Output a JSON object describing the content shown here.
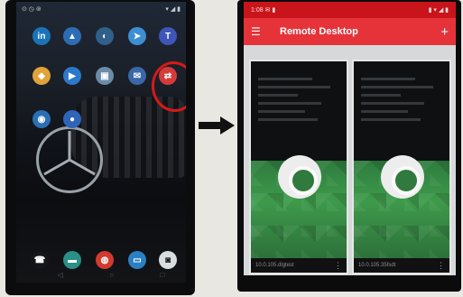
{
  "left_phone": {
    "status": {
      "left": "⊙ ◷ ⊚",
      "right": "▾ ◢ ▮"
    },
    "apps_row1": [
      {
        "icon": "linkedin-icon",
        "glyph": "in",
        "color": "#1a73b8"
      },
      {
        "icon": "drive-icon",
        "glyph": "▲",
        "color": "#2d6db3"
      },
      {
        "icon": "app-icon",
        "glyph": "◐",
        "color": "#305f8a"
      },
      {
        "icon": "telegram-icon",
        "glyph": "➤",
        "color": "#3d8fd1"
      },
      {
        "icon": "teams-icon",
        "glyph": "T",
        "color": "#3f55b8"
      }
    ],
    "apps_row2": [
      {
        "icon": "sketch-icon",
        "glyph": "◆",
        "color": "#e0a23a"
      },
      {
        "icon": "play-icon",
        "glyph": "▶",
        "color": "#2c79c9"
      },
      {
        "icon": "photos-icon",
        "glyph": "▣",
        "color": "#6b8ca8"
      },
      {
        "icon": "mail-icon",
        "glyph": "✉",
        "color": "#3a67a8"
      },
      {
        "icon": "remote-desktop-icon",
        "glyph": "⇄",
        "color": "#d63b3b"
      }
    ],
    "apps_row3": [
      {
        "icon": "phone-app-icon",
        "glyph": "◉",
        "color": "#2a6fb5"
      },
      {
        "icon": "info-icon",
        "glyph": "●",
        "color": "#2f64b8"
      }
    ],
    "dock": [
      {
        "icon": "call-icon",
        "glyph": "☎",
        "color": "#14161a"
      },
      {
        "icon": "messages-icon",
        "glyph": "▬",
        "color": "#2a8f86"
      },
      {
        "icon": "chrome-icon",
        "glyph": "◍",
        "color": "#d23a2e"
      },
      {
        "icon": "email-icon",
        "glyph": "▭",
        "color": "#2b80c4"
      },
      {
        "icon": "camera-icon",
        "glyph": "◙",
        "color": "#d9dde0"
      }
    ]
  },
  "right_phone": {
    "status": {
      "left": "1:08 ✉ ▮",
      "right": "▮ ▾ ◢ ▮"
    },
    "app_title": "Remote Desktop",
    "tiles": [
      {
        "footer": "10.0.105.dlgtest"
      },
      {
        "footer": "10.0.105.35fsdt"
      }
    ]
  },
  "colors": {
    "accent": "#e53339",
    "annotation": "#d61a1a"
  }
}
